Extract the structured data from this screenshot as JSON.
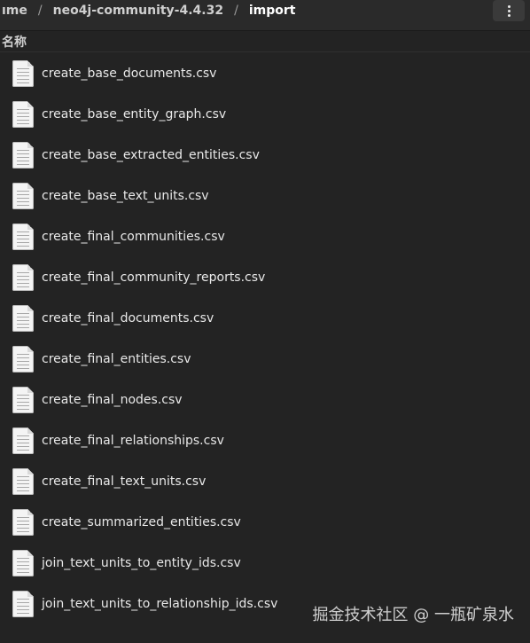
{
  "pathbar": {
    "crumbs": [
      "ıme",
      "neo4j-community-4.4.32",
      "import"
    ],
    "separator": "/"
  },
  "column_header": "名称",
  "menu_icon": "vertical-dots-icon",
  "files": [
    {
      "name": "create_base_documents.csv",
      "icon": "text-file-icon"
    },
    {
      "name": "create_base_entity_graph.csv",
      "icon": "text-file-icon"
    },
    {
      "name": "create_base_extracted_entities.csv",
      "icon": "text-file-icon"
    },
    {
      "name": "create_base_text_units.csv",
      "icon": "text-file-icon"
    },
    {
      "name": "create_final_communities.csv",
      "icon": "text-file-icon"
    },
    {
      "name": "create_final_community_reports.csv",
      "icon": "text-file-icon"
    },
    {
      "name": "create_final_documents.csv",
      "icon": "text-file-icon"
    },
    {
      "name": "create_final_entities.csv",
      "icon": "text-file-icon"
    },
    {
      "name": "create_final_nodes.csv",
      "icon": "text-file-icon"
    },
    {
      "name": "create_final_relationships.csv",
      "icon": "text-file-icon"
    },
    {
      "name": "create_final_text_units.csv",
      "icon": "text-file-icon"
    },
    {
      "name": "create_summarized_entities.csv",
      "icon": "text-file-icon"
    },
    {
      "name": "join_text_units_to_entity_ids.csv",
      "icon": "text-file-icon"
    },
    {
      "name": "join_text_units_to_relationship_ids.csv",
      "icon": "text-file-icon"
    }
  ],
  "watermark": "掘金技术社区 @ 一瓶矿泉水"
}
